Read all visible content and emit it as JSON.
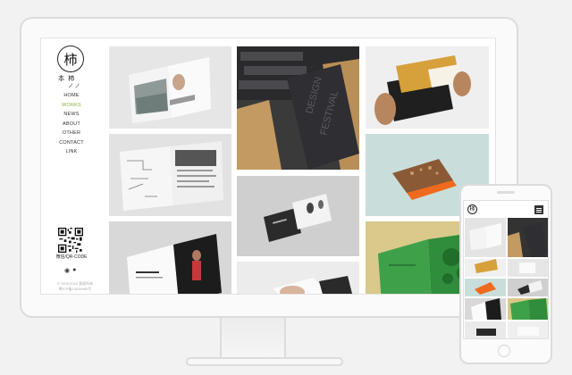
{
  "brand": {
    "logo_char": "柿",
    "name_cn": "本 柿",
    "name_sub": "ノ ノ"
  },
  "nav": [
    "HOME",
    "WORKS",
    "NEWS",
    "ABOUT",
    "OTHER",
    "CONTACT",
    "LINK"
  ],
  "nav_active": "WORKS",
  "qr_label": "微信/QR-CODE",
  "social_icons": [
    "weibo-icon",
    "wechat-icon"
  ],
  "footer": {
    "line1": "© 2005-2015 版权所有",
    "line2": "粤ICP备14026985号"
  },
  "phone": {
    "logo_char": "柿",
    "menu_icon": "menu-icon"
  },
  "colors": {
    "accent": "#8bb03a",
    "background": "#f2f2f2"
  }
}
